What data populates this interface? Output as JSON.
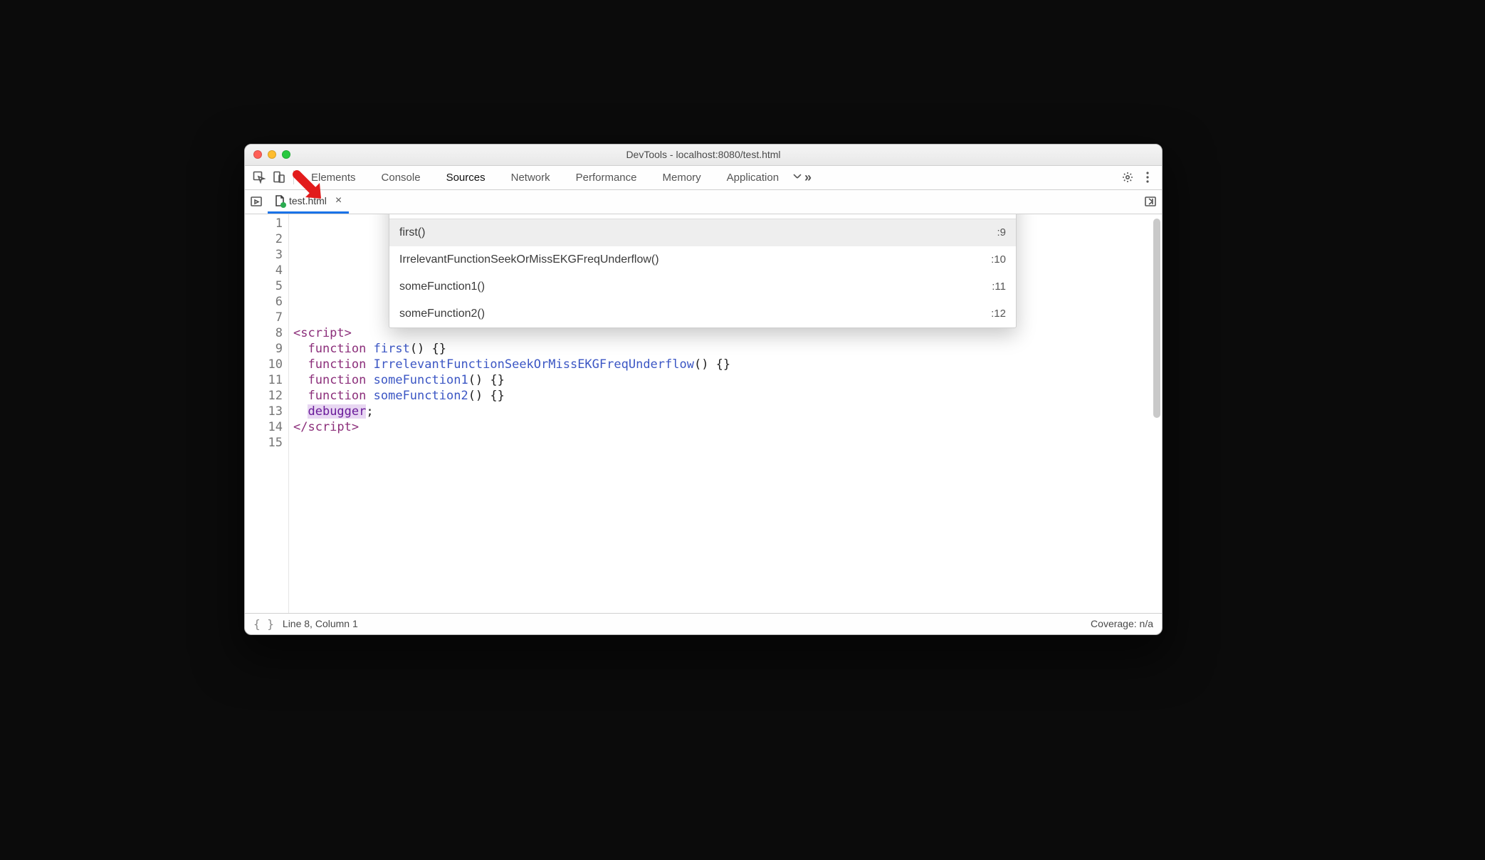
{
  "window": {
    "title": "DevTools - localhost:8080/test.html"
  },
  "tabs": {
    "items": [
      "Elements",
      "Console",
      "Sources",
      "Network",
      "Performance",
      "Memory",
      "Application"
    ],
    "active": "Sources"
  },
  "file_tab": {
    "name": "test.html"
  },
  "quick_open": {
    "query": "@",
    "results": [
      {
        "label": "first()",
        "line": ":9"
      },
      {
        "label": "IrrelevantFunctionSeekOrMissEKGFreqUnderflow()",
        "line": ":10"
      },
      {
        "label": "someFunction1()",
        "line": ":11"
      },
      {
        "label": "someFunction2()",
        "line": ":12"
      }
    ]
  },
  "gutter_lines": [
    "1",
    "2",
    "3",
    "4",
    "5",
    "6",
    "7",
    "8",
    "9",
    "10",
    "11",
    "12",
    "13",
    "14",
    "15"
  ],
  "code": {
    "l9_fn": "first",
    "l10_fn": "IrrelevantFunctionSeekOrMissEKGFreqUnderflow",
    "l11_fn": "someFunction1",
    "l12_fn": "someFunction2",
    "script_open": "<script>",
    "script_close": "</script>",
    "func_kw": "function",
    "dbg": "debugger"
  },
  "status": {
    "pos": "Line 8, Column 1",
    "coverage": "Coverage: n/a"
  }
}
